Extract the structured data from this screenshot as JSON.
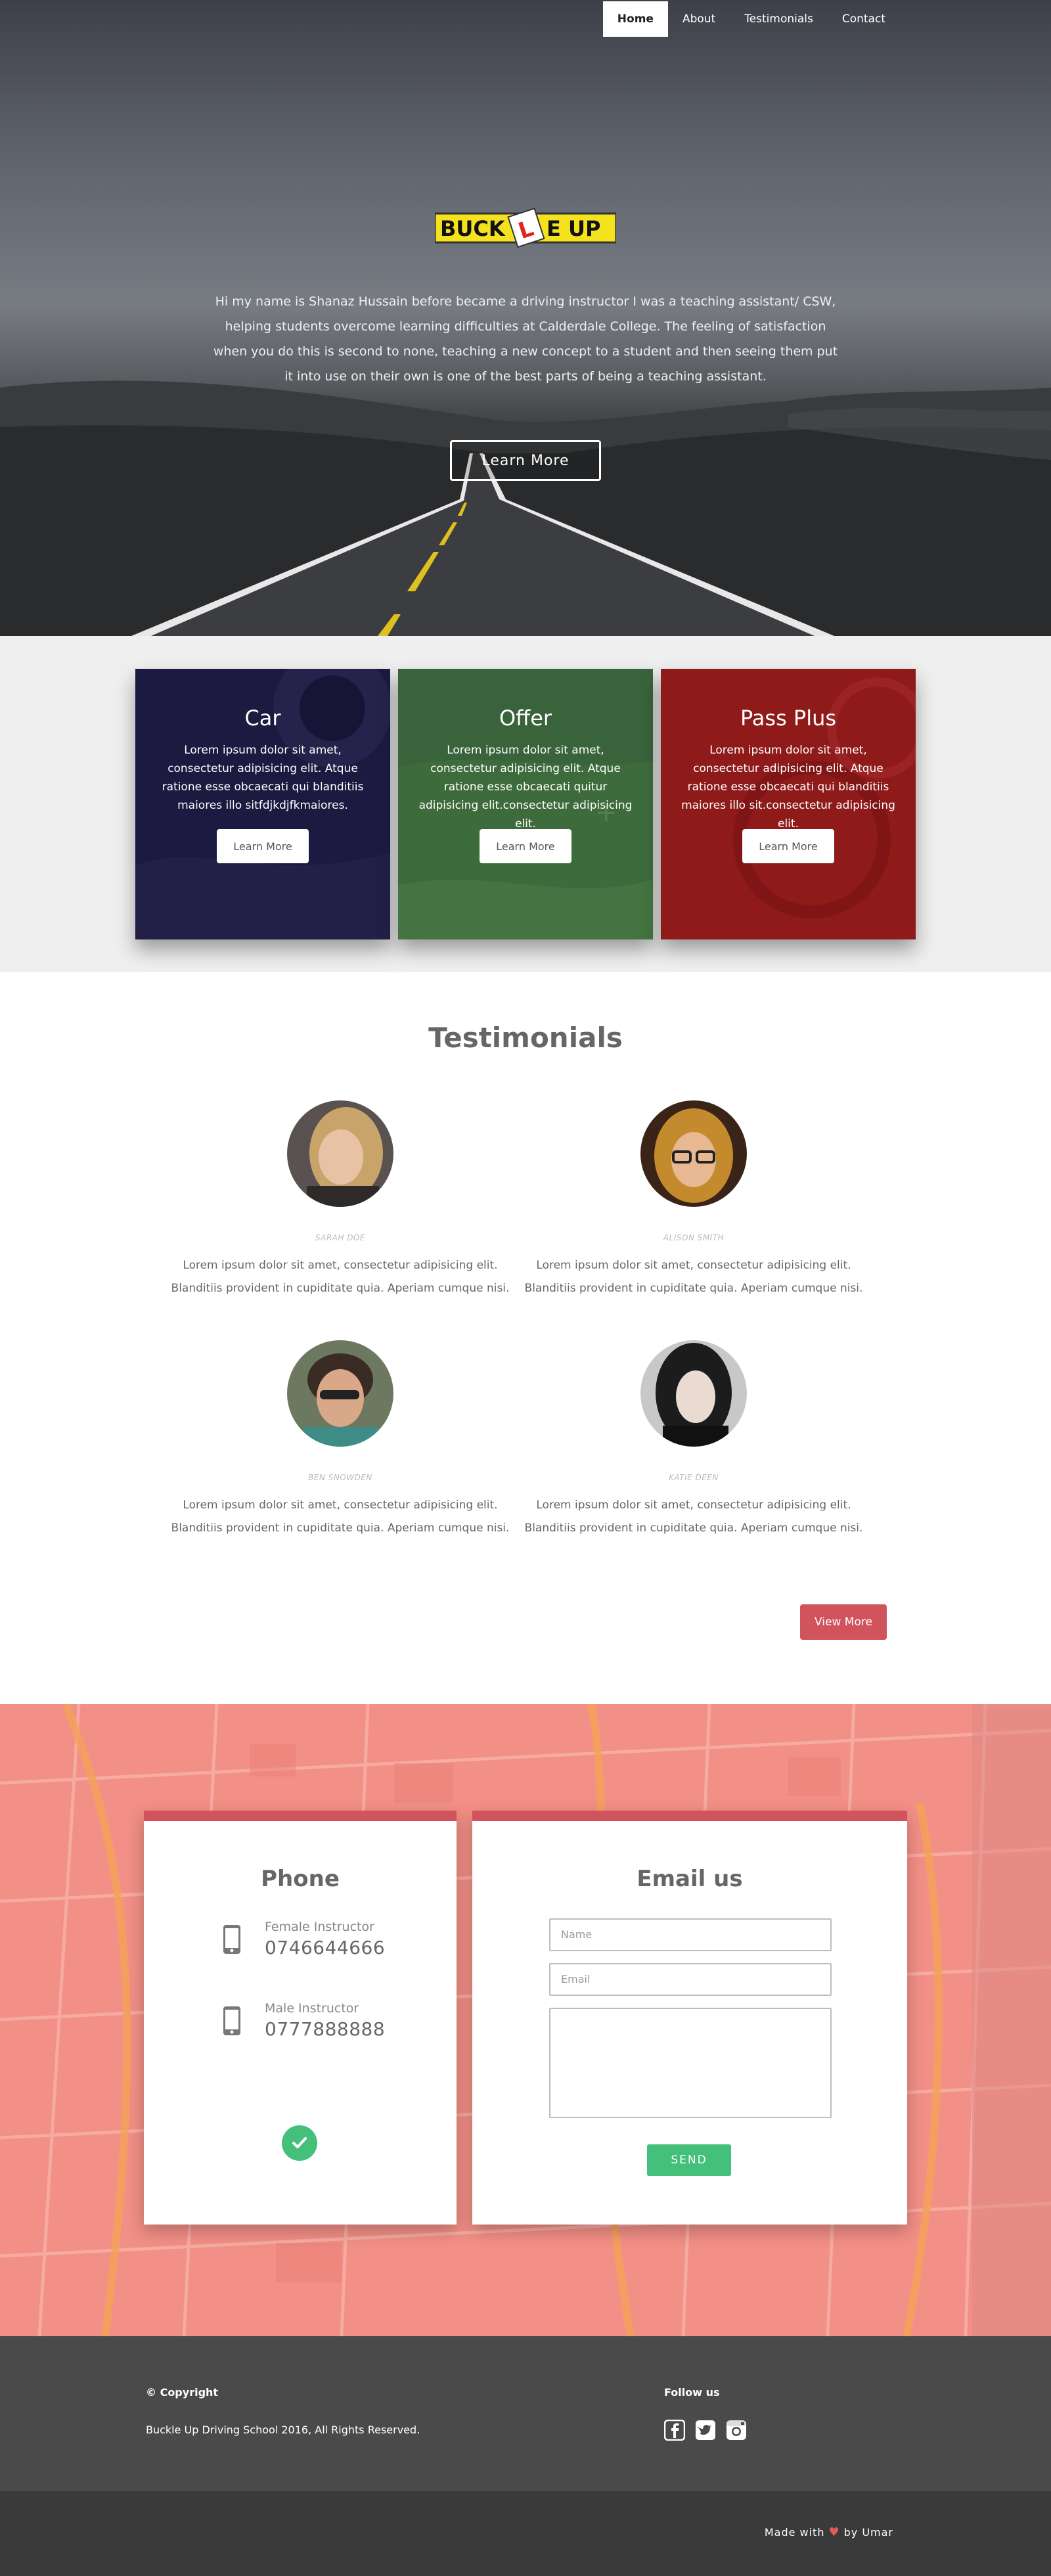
{
  "nav": {
    "items": [
      {
        "label": "Home",
        "active": true
      },
      {
        "label": "About",
        "active": false
      },
      {
        "label": "Testimonials",
        "active": false
      },
      {
        "label": "Contact",
        "active": false
      }
    ]
  },
  "hero": {
    "logo_text": "BUCK L E UP",
    "intro": "Hi my name is Shanaz Hussain before became a driving instructor I was a teaching assistant/ CSW, helping students overcome learning difficulties at Calderdale College. The feeling of satisfaction when you do this is second to none, teaching a new concept to a student and then seeing them put it into use on their own is one of the best parts of being a teaching assistant.",
    "button": "Learn More"
  },
  "services": [
    {
      "title": "Car",
      "text": "Lorem ipsum dolor sit amet, consectetur adipisicing elit. Atque ratione esse obcaecati qui blanditiis maiores illo sitfdjkdjfkmaiores.",
      "button": "Learn More",
      "color": "#1c1a40"
    },
    {
      "title": "Offer",
      "text": "Lorem ipsum dolor sit amet, consectetur adipisicing elit. Atque ratione esse obcaecati quitur adipisicing elit.consectetur adipisicing elit.",
      "button": "Learn More",
      "color": "#3e6b3c"
    },
    {
      "title": "Pass Plus",
      "text": "Lorem ipsum dolor sit amet, consectetur adipisicing elit. Atque ratione esse obcaecati qui blanditiis maiores illo sit.consectetur adipisicing elit.",
      "button": "Learn More",
      "color": "#8e1a1a"
    }
  ],
  "testimonials": {
    "title": "Testimonials",
    "items": [
      {
        "name": "SARAH DOE",
        "text": "Lorem ipsum dolor sit amet, consectetur adipisicing elit. Blanditiis provident in cupiditate quia. Aperiam cumque nisi."
      },
      {
        "name": "ALISON SMITH",
        "text": "Lorem ipsum dolor sit amet, consectetur adipisicing elit. Blanditiis provident in cupiditate quia. Aperiam cumque nisi."
      },
      {
        "name": "BEN SNOWDEN",
        "text": "Lorem ipsum dolor sit amet, consectetur adipisicing elit. Blanditiis provident in cupiditate quia. Aperiam cumque nisi."
      },
      {
        "name": "KATIE DEEN",
        "text": "Lorem ipsum dolor sit amet, consectetur adipisicing elit. Blanditiis provident in cupiditate quia. Aperiam cumque nisi."
      }
    ],
    "view_more": "View More"
  },
  "contact": {
    "phone": {
      "title": "Phone",
      "entries": [
        {
          "label": "Female Instructor",
          "number": "0746644666"
        },
        {
          "label": "Male Instructor",
          "number": "0777888888"
        }
      ]
    },
    "email": {
      "title": "Email us",
      "name_placeholder": "Name",
      "email_placeholder": "Email",
      "send": "SEND"
    },
    "accent": "#d1545d",
    "success": "#45c07a"
  },
  "footer": {
    "copyright_heading": "© Copyright",
    "copyright_text": "Buckle Up Driving School 2016, All Rights Reserved.",
    "follow_heading": "Follow us",
    "social_icons": [
      "facebook-icon",
      "twitter-icon",
      "instagram-icon"
    ],
    "made_prefix": "Made with",
    "made_suffix": "by Umar"
  }
}
